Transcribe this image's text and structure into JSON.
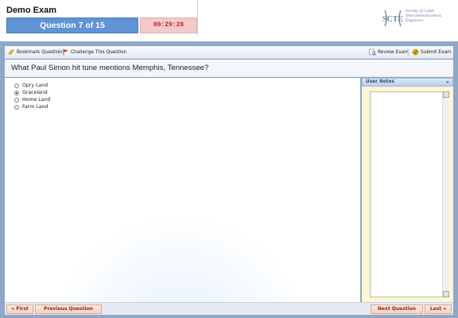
{
  "header": {
    "exam_title": "Demo Exam",
    "question_progress": "Question 7 of 15",
    "timer": "00:29:28",
    "logo": {
      "mark": "SCTE",
      "text_lines": [
        "Society of Cable",
        "Telecommunications",
        "Engineers"
      ]
    }
  },
  "toolbar": {
    "bookmark_label": "Bookmark Question",
    "challenge_label": "Challenge This Question",
    "review_label": "Review Exam",
    "submit_label": "Submit Exam",
    "icons": {
      "bookmark": "bookmark-icon",
      "challenge": "flag-icon",
      "review": "review-icon",
      "submit": "submit-icon"
    }
  },
  "question": {
    "text": "What Paul Simon hit tune mentions Memphis, Tennessee?",
    "options": [
      {
        "label": "Opry Land",
        "selected": false
      },
      {
        "label": "Graceland",
        "selected": true
      },
      {
        "label": "Home Land",
        "selected": false
      },
      {
        "label": "Farm Land",
        "selected": false
      }
    ]
  },
  "notes": {
    "title": "User Notes",
    "collapse_label": "»",
    "value": ""
  },
  "footer": {
    "first_label": "« First",
    "previous_label": "Previous Question",
    "next_label": "Next Question",
    "last_label": "Last »"
  },
  "colors": {
    "accent": "#5f93d6",
    "timer_bg": "#f3c9c9",
    "frame": "#8fa7c9",
    "nav_text": "#8b2a16"
  }
}
